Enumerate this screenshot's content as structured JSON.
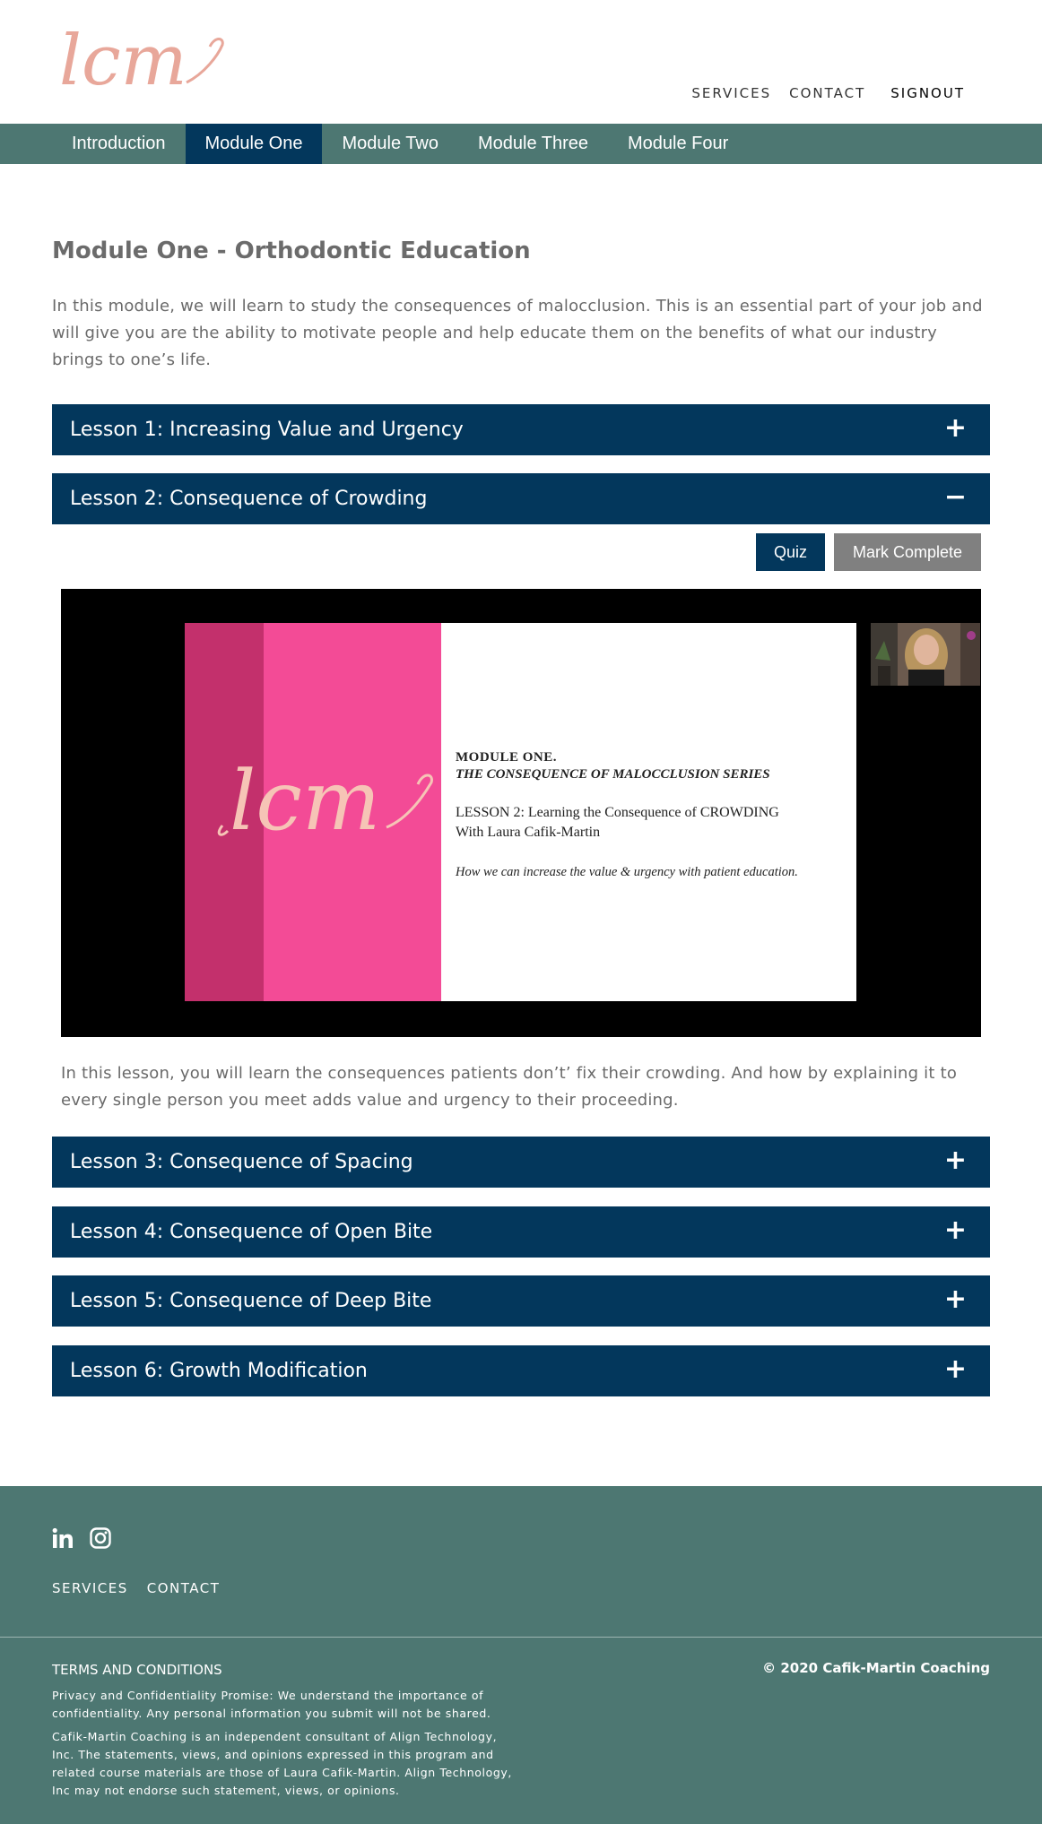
{
  "brand": {
    "logo_text": "lcm",
    "logo_color": "#e8a79a"
  },
  "header": {
    "nav": [
      "SERVICES",
      "CONTACT"
    ],
    "signout": "SIGNOUT"
  },
  "tabs": [
    {
      "label": "Introduction"
    },
    {
      "label": "Module One",
      "active": true
    },
    {
      "label": "Module Two"
    },
    {
      "label": "Module Three"
    },
    {
      "label": "Module Four"
    }
  ],
  "page": {
    "title": "Module One - Orthodontic Education",
    "intro": "In this module, we will learn to study the consequences of malocclusion. This is an essential part of your job and will give you are the ability to motivate people and help educate them on the benefits of what our industry brings to one’s life."
  },
  "lessons": [
    {
      "label": "Lesson 1: Increasing Value and Urgency",
      "toggle": "+"
    },
    {
      "label": "Lesson 2: Consequence of Crowding",
      "toggle": "−",
      "expanded": true
    },
    {
      "label": "Lesson 3: Consequence of Spacing",
      "toggle": "+"
    },
    {
      "label": "Lesson 4: Consequence of Open Bite",
      "toggle": "+"
    },
    {
      "label": "Lesson 5: Consequence of Deep Bite",
      "toggle": "+"
    },
    {
      "label": "Lesson 6: Growth Modification",
      "toggle": "+"
    }
  ],
  "lesson_actions": {
    "quiz": "Quiz",
    "complete": "Mark Complete"
  },
  "video": {
    "slide_logo": "lcm",
    "line1": "MODULE ONE.",
    "line2": "THE CONSEQUENCE OF MALOCCLUSION SERIES",
    "line3": "LESSON 2: Learning the Consequence of CROWDING",
    "line4": "With Laura Cafik-Martin",
    "line5": "How we can increase the value & urgency with patient education."
  },
  "lesson_description": "In this lesson, you will learn the consequences patients don’t’ fix their crowding. And how by explaining it to every single person you meet adds value and urgency to their proceeding.",
  "footer": {
    "social_icons": [
      "linkedin-icon",
      "instagram-icon"
    ],
    "nav": [
      "SERVICES",
      "CONTACT"
    ],
    "terms": "TERMS AND CONDITIONS",
    "copyright": "© 2020 Cafik-Martin Coaching",
    "privacy": "Privacy and Confidentiality Promise: We understand the importance of confidentiality. Any personal information you submit will not be shared.",
    "disclaimer": "Cafik-Martin Coaching is an independent consultant of Align Technology, Inc. The statements, views, and opinions expressed in this program and related course materials are those of Laura Cafik-Martin. Align Technology, Inc may not endorse such statement, views, or opinions."
  },
  "colors": {
    "navy": "#03375c",
    "teal": "#4d7772",
    "grey_button": "#808080",
    "pink": "#f34b96",
    "dark_pink": "#c3306c"
  }
}
